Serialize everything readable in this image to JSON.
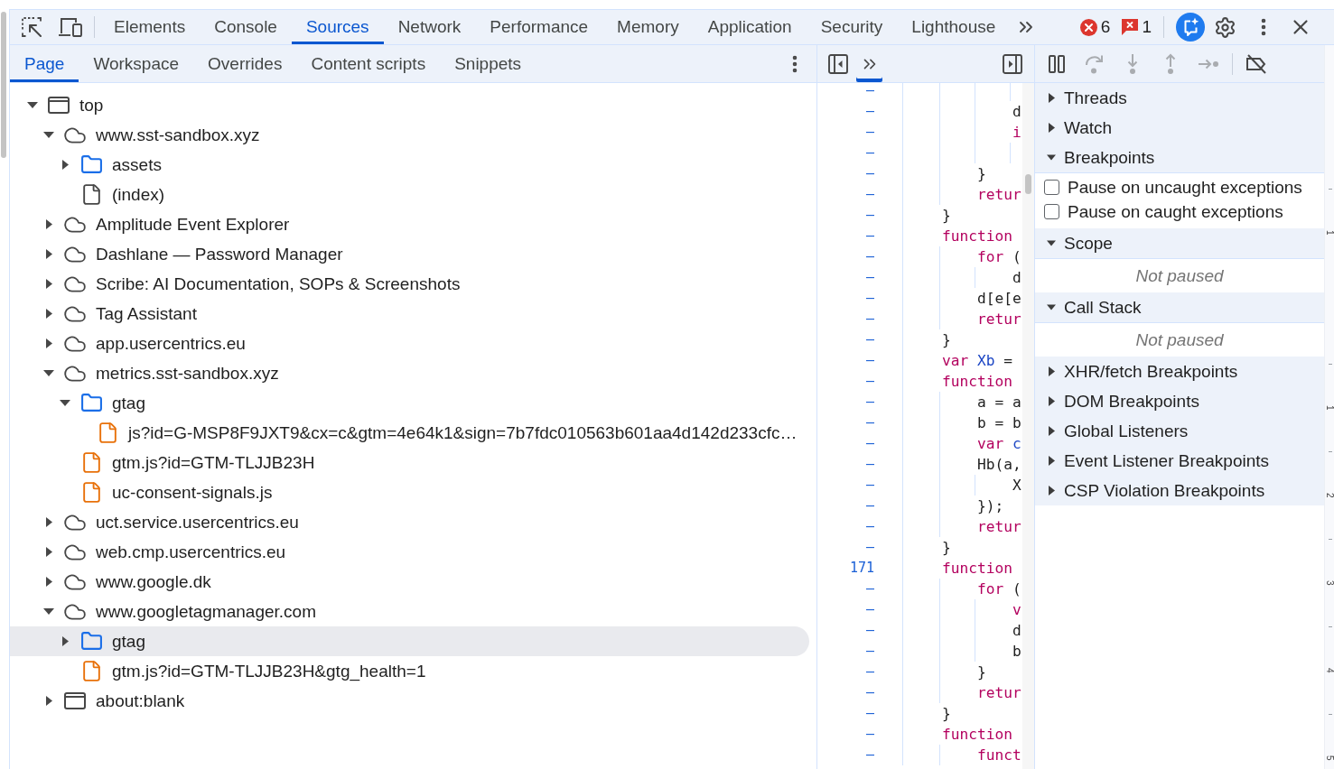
{
  "main_tabs": [
    {
      "label": "Elements",
      "selected": false
    },
    {
      "label": "Console",
      "selected": false
    },
    {
      "label": "Sources",
      "selected": true
    },
    {
      "label": "Network",
      "selected": false
    },
    {
      "label": "Performance",
      "selected": false
    },
    {
      "label": "Memory",
      "selected": false
    },
    {
      "label": "Application",
      "selected": false
    },
    {
      "label": "Security",
      "selected": false
    },
    {
      "label": "Lighthouse",
      "selected": false
    }
  ],
  "console_counts": {
    "errors": "6",
    "issues": "1"
  },
  "navigator": {
    "tabs": [
      {
        "label": "Page",
        "selected": true
      },
      {
        "label": "Workspace",
        "selected": false
      },
      {
        "label": "Overrides",
        "selected": false
      },
      {
        "label": "Content scripts",
        "selected": false
      },
      {
        "label": "Snippets",
        "selected": false
      }
    ],
    "tree": [
      {
        "kind": "frame",
        "label": "top",
        "expanded": true,
        "selected": false,
        "children": [
          {
            "kind": "domain",
            "label": "www.sst-sandbox.xyz",
            "expanded": true,
            "selected": false,
            "children": [
              {
                "kind": "folder",
                "label": "assets",
                "expanded": false,
                "selected": false
              },
              {
                "kind": "file",
                "label": "(index)",
                "selected": false
              }
            ]
          },
          {
            "kind": "domain",
            "label": "Amplitude Event Explorer",
            "expanded": false,
            "selected": false
          },
          {
            "kind": "domain",
            "label": "Dashlane — Password Manager",
            "expanded": false,
            "selected": false
          },
          {
            "kind": "domain",
            "label": "Scribe: AI Documentation, SOPs & Screenshots",
            "expanded": false,
            "selected": false
          },
          {
            "kind": "domain",
            "label": "Tag Assistant",
            "expanded": false,
            "selected": false
          },
          {
            "kind": "domain",
            "label": "app.usercentrics.eu",
            "expanded": false,
            "selected": false
          },
          {
            "kind": "domain",
            "label": "metrics.sst-sandbox.xyz",
            "expanded": true,
            "selected": false,
            "children": [
              {
                "kind": "folder",
                "label": "gtag",
                "expanded": true,
                "selected": false,
                "children": [
                  {
                    "kind": "script",
                    "label": "js?id=G-MSP8F9JXT9&cx=c&gtm=4e64k1&sign=7b7fdc010563b601aa4d142d233cfc…",
                    "selected": false
                  }
                ]
              },
              {
                "kind": "script",
                "label": "gtm.js?id=GTM-TLJJB23H",
                "selected": false
              },
              {
                "kind": "script",
                "label": "uc-consent-signals.js",
                "selected": false
              }
            ]
          },
          {
            "kind": "domain",
            "label": "uct.service.usercentrics.eu",
            "expanded": false,
            "selected": false
          },
          {
            "kind": "domain",
            "label": "web.cmp.usercentrics.eu",
            "expanded": false,
            "selected": false
          },
          {
            "kind": "domain",
            "label": "www.google.dk",
            "expanded": false,
            "selected": false
          },
          {
            "kind": "domain",
            "label": "www.googletagmanager.com",
            "expanded": true,
            "selected": false,
            "children": [
              {
                "kind": "folder",
                "label": "gtag",
                "expanded": false,
                "selected": true
              },
              {
                "kind": "script",
                "label": "gtm.js?id=GTM-TLJJB23H&gtg_health=1",
                "selected": false
              }
            ]
          },
          {
            "kind": "frame",
            "label": "about:blank",
            "expanded": false,
            "selected": false
          }
        ]
      }
    ]
  },
  "editor": {
    "lines": [
      {
        "children": [
          {
            "children": [
              {
                "children": [
                  {
                    "line_number": "–"
                  }
                ]
              },
              {
                "line_number": "–",
                "tokens": [
                  {
                    "kind": "plain",
                    "text": "d"
                  }
                ]
              },
              {
                "line_number": "–",
                "tokens": [
                  {
                    "kind": "keyword",
                    "text": "i"
                  }
                ],
                "children": [
                  {
                    "line_number": "–"
                  }
                ]
              }
            ]
          },
          {
            "line_number": "–",
            "tokens": [
              {
                "kind": "plain",
                "text": "}"
              }
            ]
          },
          {
            "line_number": "–",
            "tokens": [
              {
                "kind": "keyword",
                "text": "retur"
              }
            ]
          }
        ]
      },
      {
        "line_number": "–",
        "tokens": [
          {
            "kind": "plain",
            "text": "}"
          }
        ]
      },
      {
        "line_number": "–",
        "tokens": [
          {
            "kind": "keyword",
            "text": "function"
          }
        ],
        "children": [
          {
            "line_number": "–",
            "tokens": [
              {
                "kind": "keyword",
                "text": "for"
              },
              {
                "kind": "plain",
                "text": " ("
              }
            ],
            "children": [
              {
                "line_number": "–",
                "tokens": [
                  {
                    "kind": "plain",
                    "text": "d"
                  }
                ]
              }
            ]
          },
          {
            "line_number": "–",
            "tokens": [
              {
                "kind": "plain",
                "text": "d[e[e"
              }
            ]
          },
          {
            "line_number": "–",
            "tokens": [
              {
                "kind": "keyword",
                "text": "retur"
              }
            ]
          }
        ]
      },
      {
        "line_number": "–",
        "tokens": [
          {
            "kind": "plain",
            "text": "}"
          }
        ]
      },
      {
        "line_number": "–",
        "tokens": [
          {
            "kind": "keyword",
            "text": "var"
          },
          {
            "kind": "definition",
            "text": " Xb"
          },
          {
            "kind": "plain",
            "text": " ="
          }
        ]
      },
      {
        "line_number": "–",
        "tokens": [
          {
            "kind": "keyword",
            "text": "function"
          }
        ],
        "children": [
          {
            "line_number": "–",
            "tokens": [
              {
                "kind": "plain",
                "text": "a = a"
              }
            ]
          },
          {
            "line_number": "–",
            "tokens": [
              {
                "kind": "plain",
                "text": "b = b"
              }
            ]
          },
          {
            "line_number": "–",
            "tokens": [
              {
                "kind": "keyword",
                "text": "var"
              },
              {
                "kind": "definition",
                "text": " c"
              }
            ]
          },
          {
            "line_number": "–",
            "tokens": [
              {
                "kind": "plain",
                "text": "Hb(a,"
              }
            ],
            "children": [
              {
                "line_number": "–",
                "tokens": [
                  {
                    "kind": "plain",
                    "text": "X"
                  }
                ]
              }
            ]
          },
          {
            "line_number": "–",
            "tokens": [
              {
                "kind": "plain",
                "text": "});"
              }
            ]
          },
          {
            "line_number": "–",
            "tokens": [
              {
                "kind": "keyword",
                "text": "retur"
              }
            ]
          }
        ]
      },
      {
        "line_number": "–",
        "tokens": [
          {
            "kind": "plain",
            "text": "}"
          }
        ]
      },
      {
        "line_number": "171",
        "tokens": [
          {
            "kind": "keyword",
            "text": "function"
          }
        ],
        "children": [
          {
            "line_number": "–",
            "tokens": [
              {
                "kind": "keyword",
                "text": "for"
              },
              {
                "kind": "plain",
                "text": " ("
              }
            ],
            "children": [
              {
                "line_number": "–",
                "tokens": [
                  {
                    "kind": "keyword",
                    "text": "v"
                  }
                ]
              },
              {
                "line_number": "–",
                "tokens": [
                  {
                    "kind": "plain",
                    "text": "d"
                  }
                ]
              },
              {
                "line_number": "–",
                "tokens": [
                  {
                    "kind": "plain",
                    "text": "b"
                  }
                ]
              }
            ]
          },
          {
            "line_number": "–",
            "tokens": [
              {
                "kind": "plain",
                "text": "}"
              }
            ]
          },
          {
            "line_number": "–",
            "tokens": [
              {
                "kind": "keyword",
                "text": "retur"
              }
            ]
          }
        ]
      },
      {
        "line_number": "–",
        "tokens": [
          {
            "kind": "plain",
            "text": "}"
          }
        ]
      },
      {
        "line_number": "–",
        "tokens": [
          {
            "kind": "keyword",
            "text": "function"
          }
        ],
        "children": [
          {
            "line_number": "–",
            "tokens": [
              {
                "kind": "keyword",
                "text": "funct"
              }
            ]
          }
        ]
      }
    ]
  },
  "debugger": {
    "toolbar": [
      {
        "kind": "pause",
        "disabled": false
      },
      {
        "kind": "step_over",
        "disabled": true
      },
      {
        "kind": "step_into",
        "disabled": true
      },
      {
        "kind": "step_out",
        "disabled": true
      },
      {
        "kind": "step",
        "disabled": true
      },
      {
        "kind": "deactivate_breakpoints",
        "disabled": false
      }
    ],
    "sections": [
      {
        "title": "Threads",
        "expanded": false
      },
      {
        "title": "Watch",
        "expanded": false
      },
      {
        "title": "Breakpoints",
        "expanded": true,
        "checkboxes": [
          {
            "label": "Pause on uncaught exceptions",
            "checked": false
          },
          {
            "label": "Pause on caught exceptions",
            "checked": false
          }
        ]
      },
      {
        "title": "Scope",
        "expanded": true,
        "message": "Not paused"
      },
      {
        "title": "Call Stack",
        "expanded": true,
        "message": "Not paused"
      },
      {
        "title": "XHR/fetch Breakpoints",
        "expanded": false
      },
      {
        "title": "DOM Breakpoints",
        "expanded": false
      },
      {
        "title": "Global Listeners",
        "expanded": false
      },
      {
        "title": "Event Listener Breakpoints",
        "expanded": false
      },
      {
        "title": "CSP Violation Breakpoints",
        "expanded": false
      }
    ]
  },
  "ruler": {
    "labels": [
      "1",
      "1",
      "2",
      "3",
      "4",
      "5"
    ]
  }
}
